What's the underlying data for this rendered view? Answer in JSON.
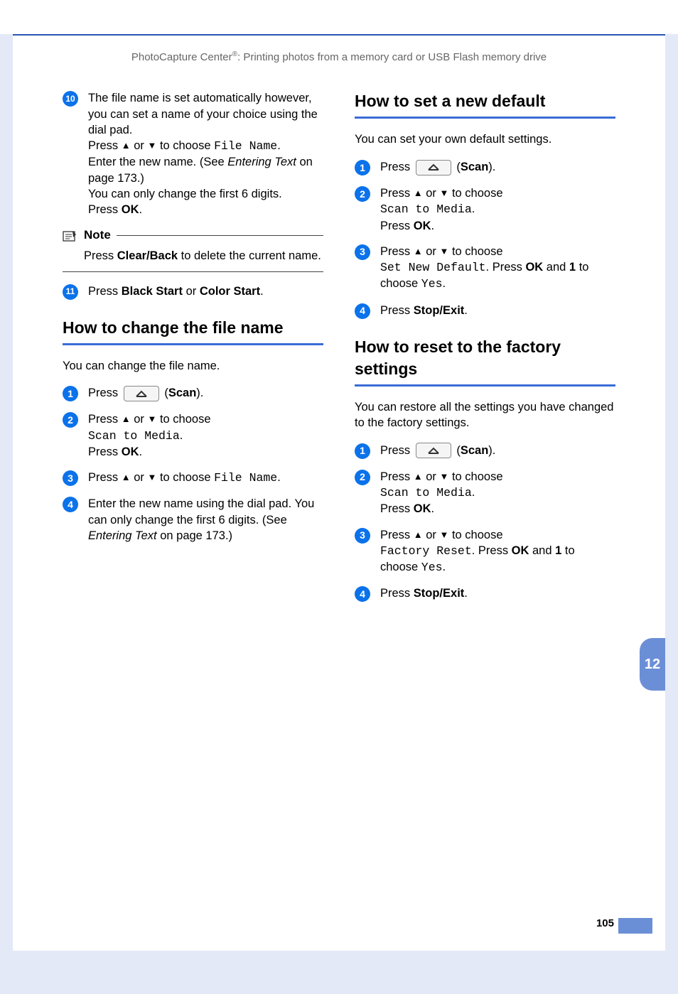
{
  "header": {
    "prefix": "PhotoCapture Center",
    "sup": "®",
    "rest": ": Printing photos from a memory card or USB Flash memory drive"
  },
  "left": {
    "step10": {
      "num": "10",
      "l1": "The file name is set automatically however, you can set a name of your choice using the dial pad.",
      "l2a": "Press ",
      "l2b": " or ",
      "l2c": " to choose ",
      "l2mono": "File Name",
      "l2d": ".",
      "l3a": "Enter the new name. (See ",
      "l3i": "Entering Text",
      "l3b": " on page 173.)",
      "l4": "You can only change the first 6 digits.",
      "l5a": "Press ",
      "l5b": "OK",
      "l5c": "."
    },
    "note": {
      "title": "Note",
      "body_a": "Press ",
      "body_b": "Clear/Back",
      "body_c": " to delete the current name."
    },
    "step11": {
      "num": "11",
      "a": "Press ",
      "b": "Black Start",
      "c": " or ",
      "d": "Color Start",
      "e": "."
    },
    "sectionA": {
      "title": "How to change the file name",
      "intro": "You can change the file name.",
      "s1": {
        "num": "1",
        "a": "Press ",
        "b": " (",
        "c": "Scan",
        "d": ")."
      },
      "s2": {
        "num": "2",
        "a": "Press ",
        "b": " or ",
        "c": " to choose ",
        "mono": "Scan to Media",
        "d": ".",
        "e": "Press ",
        "f": "OK",
        "g": "."
      },
      "s3": {
        "num": "3",
        "a": "Press ",
        "b": " or ",
        "c": " to choose ",
        "mono": "File Name",
        "d": "."
      },
      "s4": {
        "num": "4",
        "a": "Enter the new name using the dial pad. You can only change the first 6 digits. (See ",
        "i": "Entering Text",
        "b": " on page 173.)"
      }
    }
  },
  "right": {
    "sectionB": {
      "title": "How to set a new default",
      "intro": "You can set your own default settings.",
      "s1": {
        "num": "1",
        "a": "Press ",
        "b": " (",
        "c": "Scan",
        "d": ")."
      },
      "s2": {
        "num": "2",
        "a": "Press ",
        "b": " or ",
        "c": " to choose ",
        "mono": "Scan to Media",
        "d": ".",
        "e": "Press ",
        "f": "OK",
        "g": "."
      },
      "s3": {
        "num": "3",
        "a": "Press ",
        "b": " or ",
        "c": " to choose ",
        "mono": "Set New Default",
        "d": ". Press ",
        "e": "OK",
        "f": " and ",
        "g": "1",
        "h": " to choose ",
        "mono2": "Yes",
        "i": "."
      },
      "s4": {
        "num": "4",
        "a": "Press ",
        "b": "Stop/Exit",
        "c": "."
      }
    },
    "sectionC": {
      "title": "How to reset to the factory settings",
      "intro": "You can restore all the settings you have changed to the factory settings.",
      "s1": {
        "num": "1",
        "a": "Press ",
        "b": " (",
        "c": "Scan",
        "d": ")."
      },
      "s2": {
        "num": "2",
        "a": "Press ",
        "b": " or ",
        "c": " to choose ",
        "mono": "Scan to Media",
        "d": ".",
        "e": "Press ",
        "f": "OK",
        "g": "."
      },
      "s3": {
        "num": "3",
        "a": "Press ",
        "b": " or ",
        "c": " to choose ",
        "mono": "Factory Reset",
        "d": ". Press ",
        "e": "OK",
        "f": " and ",
        "g": "1",
        "h": " to choose ",
        "mono2": "Yes",
        "i": "."
      },
      "s4": {
        "num": "4",
        "a": "Press ",
        "b": "Stop/Exit",
        "c": "."
      }
    }
  },
  "sideTab": "12",
  "pageNum": "105",
  "glyphs": {
    "up": "▲",
    "down": "▼"
  }
}
